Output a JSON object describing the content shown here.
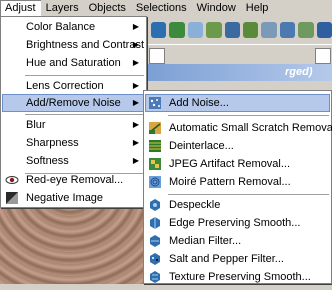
{
  "menubar": {
    "items": [
      {
        "label": "Adjust",
        "hotkey": "A"
      },
      {
        "label": "Layers",
        "hotkey": "L"
      },
      {
        "label": "Objects",
        "hotkey": "O"
      },
      {
        "label": "Selections",
        "hotkey": "S"
      },
      {
        "label": "Window",
        "hotkey": "W"
      },
      {
        "label": "Help",
        "hotkey": "H"
      }
    ]
  },
  "doc_title": "rged)",
  "adjust_menu": {
    "items": [
      {
        "label": "Color Balance",
        "submenu": true
      },
      {
        "label": "Brightness and Contrast",
        "submenu": true
      },
      {
        "label": "Hue and Saturation",
        "submenu": true
      },
      {
        "label": "Lens Correction",
        "submenu": true
      },
      {
        "label": "Add/Remove Noise",
        "submenu": true,
        "highlighted": true
      },
      {
        "label": "Blur",
        "submenu": true
      },
      {
        "label": "Sharpness",
        "submenu": true
      },
      {
        "label": "Softness",
        "submenu": true
      },
      {
        "label": "Red-eye Removal...",
        "icon": "eye-icon"
      },
      {
        "label": "Negative Image",
        "icon": "negative-image-icon"
      }
    ]
  },
  "noise_menu": {
    "items": [
      {
        "label": "Add Noise...",
        "icon": "add-noise-icon",
        "highlighted": true
      },
      {
        "label": "Automatic Small Scratch Removal...",
        "icon": "scratch-removal-icon"
      },
      {
        "label": "Deinterlace...",
        "icon": "deinterlace-icon"
      },
      {
        "label": "JPEG Artifact Removal...",
        "icon": "jpeg-artifact-icon"
      },
      {
        "label": "Moiré Pattern Removal...",
        "icon": "moire-icon"
      },
      {
        "label": "Despeckle",
        "icon": "despeckle-icon"
      },
      {
        "label": "Edge Preserving Smooth...",
        "icon": "edge-smooth-icon"
      },
      {
        "label": "Median Filter...",
        "icon": "median-filter-icon"
      },
      {
        "label": "Salt and Pepper Filter...",
        "icon": "salt-pepper-icon"
      },
      {
        "label": "Texture Preserving Smooth...",
        "icon": "texture-smooth-icon"
      }
    ]
  },
  "colors": {
    "highlight": "#b6c9ea",
    "highlight_border": "#6f8fc7",
    "menu_bg": "#ffffff",
    "chrome": "#d4d0c8"
  }
}
